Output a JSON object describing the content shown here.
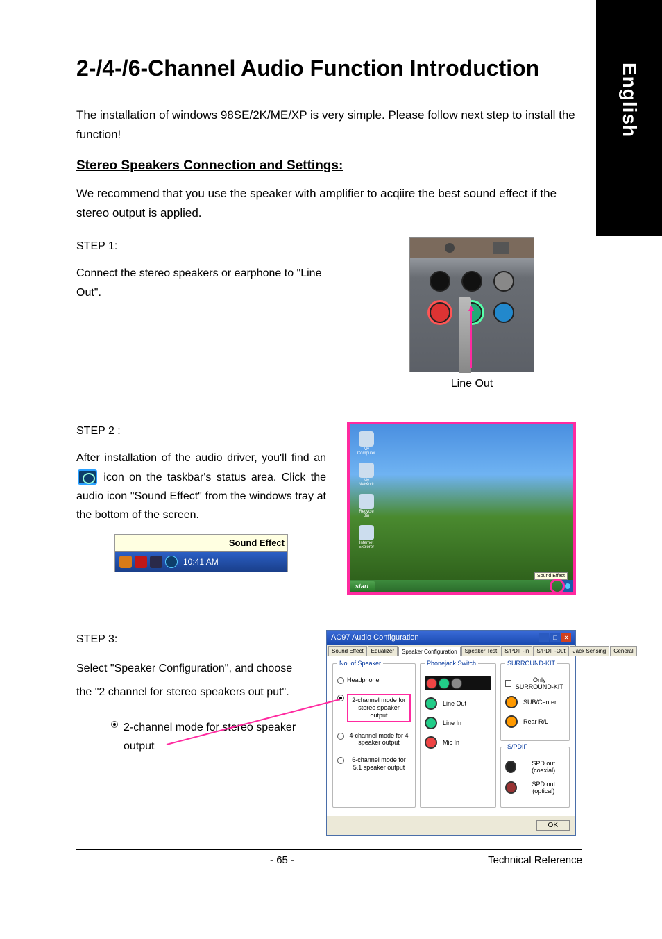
{
  "sidebar_language": "English",
  "title": "2-/4-/6-Channel Audio Function Introduction",
  "intro": "The installation of windows 98SE/2K/ME/XP is very simple. Please follow next step to install the function!",
  "subheading": "Stereo Speakers Connection and Settings:",
  "recommend": "We recommend that you use the speaker with amplifier to acqiire the best sound effect if the stereo output is applied.",
  "step1": {
    "label": "STEP 1:",
    "text": "Connect the stereo speakers or earphone to \"Line Out\".",
    "caption": "Line Out"
  },
  "step2": {
    "label": "STEP 2 :",
    "text_before": "After installation of the audio driver, you'll find an ",
    "text_after": " icon on the taskbar's status area. Click the audio icon \"Sound Effect\" from the windows tray at the bottom of the screen.",
    "tray_tooltip": "Sound Effect",
    "tray_time": "10:41 AM",
    "desktop_tooltip": "Sound Effect",
    "start_label": "start"
  },
  "step3": {
    "label": "STEP 3:",
    "text": "Select  \"Speaker Configuration\", and choose the \"2 channel for stereo speakers out put\".",
    "callout": "2-channel mode for stereo speaker output"
  },
  "ac97": {
    "window_title": "AC97 Audio Configuration",
    "tabs": [
      "Sound Effect",
      "Equalizer",
      "Speaker Configuration",
      "Speaker Test",
      "S/PDIF-In",
      "S/PDIF-Out",
      "Jack Sensing",
      "General"
    ],
    "active_tab_index": 2,
    "col_nospk_title": "No. of Speaker",
    "radio_headphone": "Headphone",
    "radio_2ch": "2-channel mode for stereo speaker output",
    "radio_4ch": "4-channel mode for 4 speaker output",
    "radio_6ch": "6-channel mode for 5.1 speaker output",
    "col_phonejack_title": "Phonejack Switch",
    "ports": {
      "line_out": "Line Out",
      "line_in": "Line In",
      "mic_in": "Mic In"
    },
    "col_surround_title": "SURROUND-KIT",
    "only_surround": "Only SURROUND-KIT",
    "sub_center": "SUB/Center",
    "rear_rl": "Rear R/L",
    "spdif_title": "S/PDIF",
    "spdif_coax": "SPD out (coaxial)",
    "spdif_opt": "SPD out (optical)",
    "ok": "OK"
  },
  "footer": {
    "page": "- 65 -",
    "section": "Technical Reference"
  }
}
